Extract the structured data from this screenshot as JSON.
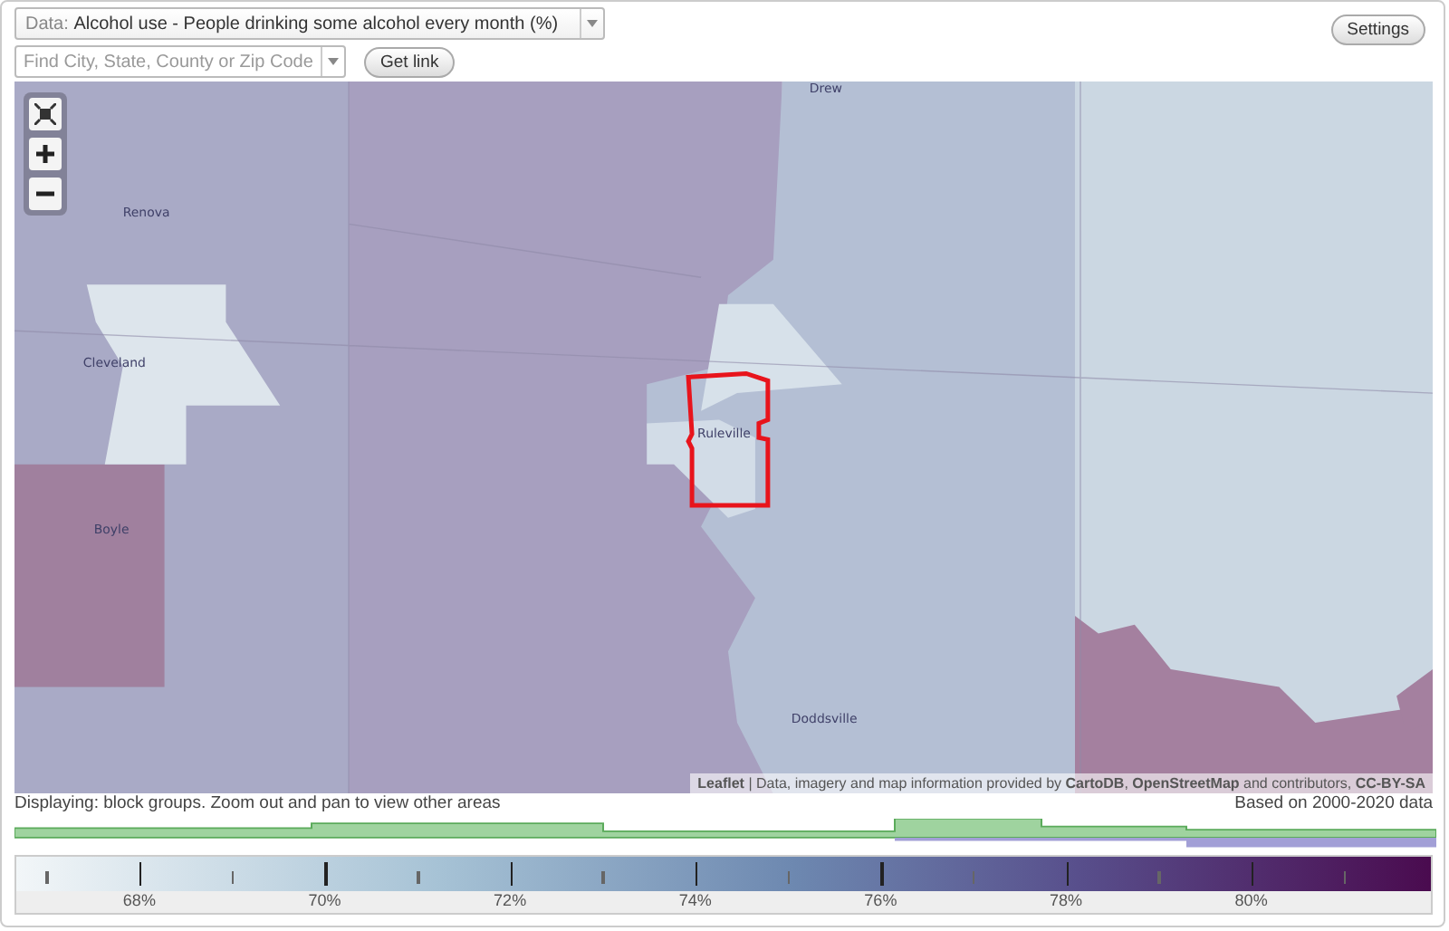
{
  "data_select": {
    "label": "Data:",
    "value": "Alcohol use - People drinking some alcohol every month (%)"
  },
  "search": {
    "placeholder": "Find City, State, County or Zip Code"
  },
  "get_link_button": "Get link",
  "settings_button": "Settings",
  "map": {
    "place_labels": [
      "Drew",
      "Renova",
      "Cleveland",
      "Boyle",
      "Ruleville",
      "Doddsville"
    ],
    "attribution": "**Leaflet** | Data, imagery and map information provided by **CartoDB**, **OpenStreetMap** and contributors, **CC-BY-SA**"
  },
  "status": "Displaying: block groups. Zoom out and pan to view other areas",
  "based_on": "Based on 2000-2020 data",
  "legend": {
    "labels": [
      "68%",
      "70%",
      "72%",
      "74%",
      "76%",
      "78%",
      "80%"
    ]
  }
}
